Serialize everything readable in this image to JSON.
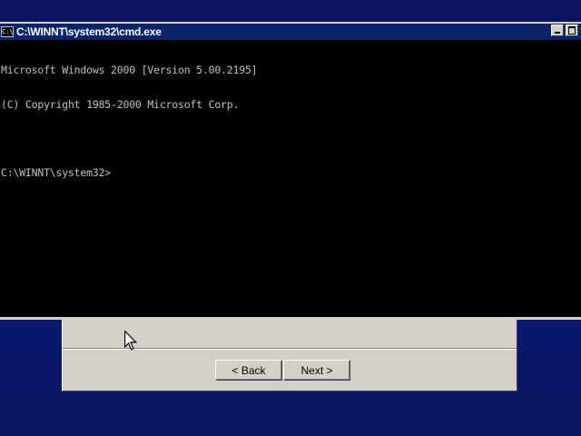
{
  "cmd_window": {
    "title": "C:\\WINNT\\system32\\cmd.exe",
    "icon": "cmd-icon",
    "console_lines": [
      "Microsoft Windows 2000 [Version 5.00.2195]",
      "(C) Copyright 1985-2000 Microsoft Corp.",
      "",
      "C:\\WINNT\\system32>"
    ]
  },
  "wizard": {
    "back_label": "< Back",
    "next_label": "Next >"
  },
  "colors": {
    "desktop": "#0b1a6e",
    "titlebar": "#0a246a",
    "console_bg": "#000000",
    "console_text": "#c0c0c0",
    "button_face": "#d4d0c8"
  }
}
